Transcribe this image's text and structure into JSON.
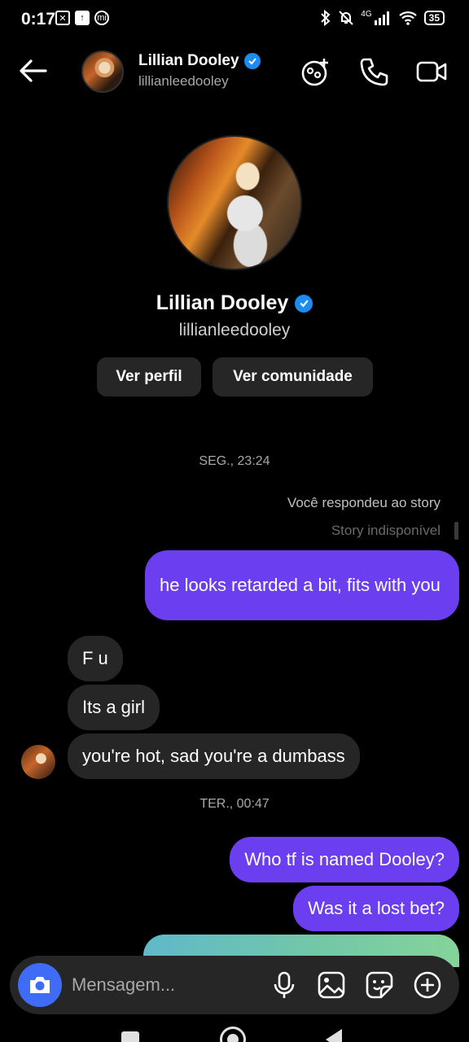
{
  "status_bar": {
    "time": "0:17",
    "network": "4G",
    "battery": "35"
  },
  "header": {
    "name": "Lillian Dooley",
    "username": "lillianleedooley"
  },
  "profile": {
    "name": "Lillian Dooley",
    "username": "lillianleedooley",
    "view_profile_label": "Ver perfil",
    "view_community_label": "Ver comunidade"
  },
  "chat": {
    "timestamp_1": "SEG., 23:24",
    "reply_note": "Você respondeu ao story",
    "story_unavailable": "Story indisponível",
    "messages": [
      {
        "from": "me",
        "text": "he looks retarded a bit, fits with you"
      },
      {
        "from": "them",
        "text": "F u"
      },
      {
        "from": "them",
        "text": "Its a girl"
      },
      {
        "from": "them",
        "text": "you're hot, sad you're a dumbass"
      },
      {
        "from": "me",
        "text": "Who tf is named Dooley?"
      },
      {
        "from": "me",
        "text": "Was it a lost bet?"
      }
    ],
    "timestamp_2": "TER., 00:47"
  },
  "composer": {
    "placeholder": "Mensagem..."
  },
  "colors": {
    "sent_bubble": "#6b3ef0",
    "received_bubble": "#262626",
    "verified": "#1d8cf0",
    "camera_button": "#3f6cf7"
  }
}
